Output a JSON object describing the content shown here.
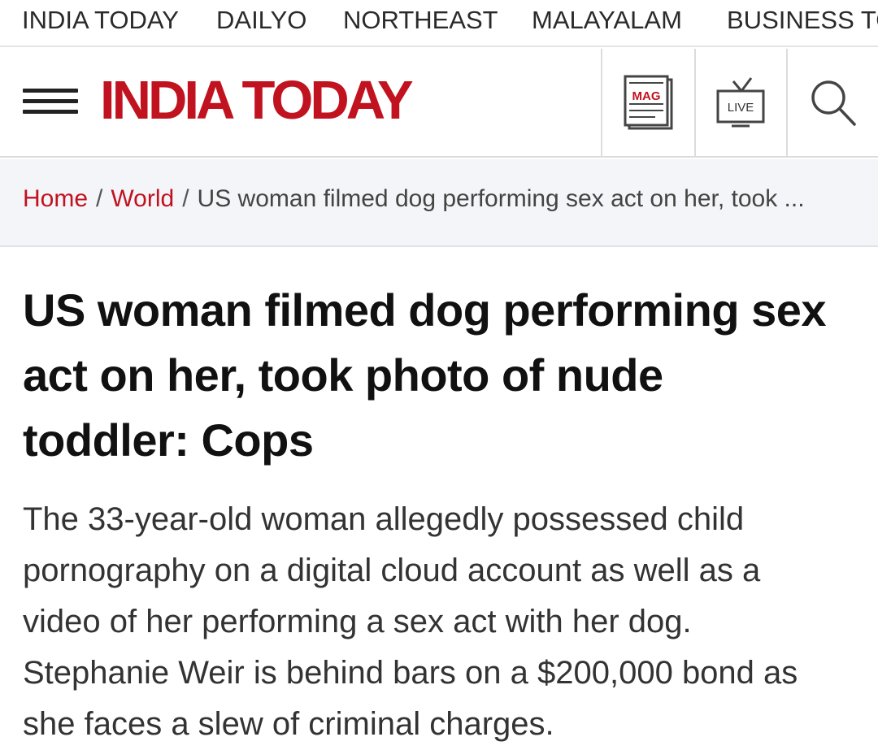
{
  "network_nav": {
    "items": [
      "INDIA TODAY",
      "DAILYO",
      "NORTHEAST",
      "MALAYALAM",
      "BUSINESS TODAY"
    ]
  },
  "header": {
    "logo": "INDIA TODAY",
    "mag_label": "MAG",
    "live_label": "LIVE"
  },
  "breadcrumb": {
    "home": "Home",
    "section": "World",
    "current": "US woman filmed dog performing sex act on her, took ..."
  },
  "article": {
    "headline": "US woman filmed dog performing sex act on her, took photo of nude toddler: Cops",
    "summary": "The 33-year-old woman allegedly possessed child pornography on a digital cloud account as well as a video of her performing a sex act with her dog. Stephanie Weir is behind bars on a $200,000 bond as she faces a slew of criminal charges."
  },
  "colors": {
    "brand_red": "#c1121f",
    "breadcrumb_bg": "#f4f5f9",
    "text_dark": "#111111"
  },
  "icons": [
    "menu-icon",
    "magazine-icon",
    "live-tv-icon",
    "search-icon"
  ]
}
